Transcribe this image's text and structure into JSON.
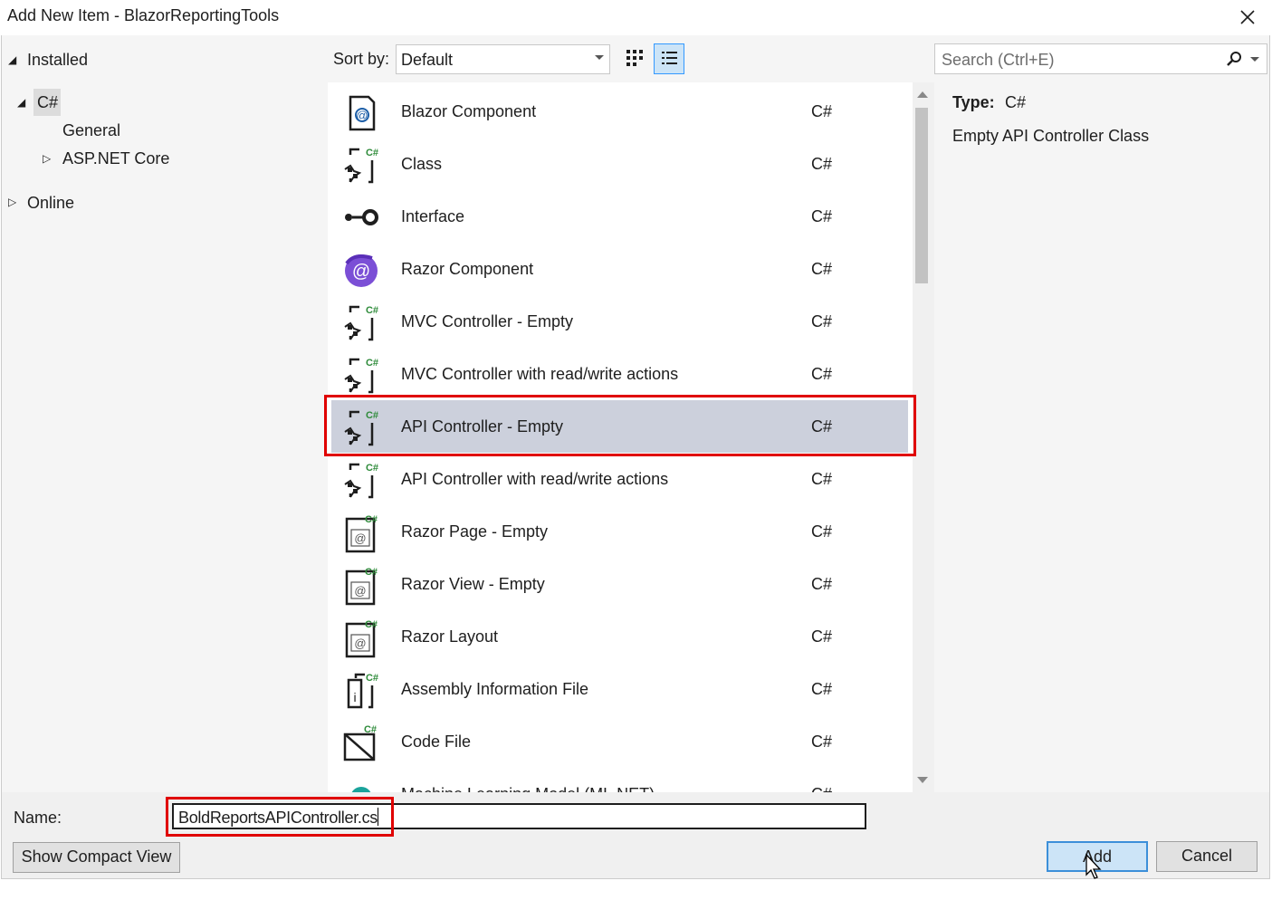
{
  "window": {
    "title": "Add New Item - BlazorReportingTools"
  },
  "tree": {
    "installed": "Installed",
    "csharp": "C#",
    "general": "General",
    "aspnet": "ASP.NET Core",
    "online": "Online"
  },
  "toolbar": {
    "sort_label": "Sort by:",
    "sort_value": "Default",
    "search_placeholder": "Search (Ctrl+E)"
  },
  "templates": [
    {
      "name": "Blazor Component",
      "lang": "C#",
      "icon": "blazor-component-icon"
    },
    {
      "name": "Class",
      "lang": "C#",
      "icon": "class-icon"
    },
    {
      "name": "Interface",
      "lang": "C#",
      "icon": "interface-icon"
    },
    {
      "name": "Razor Component",
      "lang": "C#",
      "icon": "razor-component-icon"
    },
    {
      "name": "MVC Controller - Empty",
      "lang": "C#",
      "icon": "controller-icon"
    },
    {
      "name": "MVC Controller with read/write actions",
      "lang": "C#",
      "icon": "controller-icon"
    },
    {
      "name": "API Controller - Empty",
      "lang": "C#",
      "icon": "controller-icon",
      "selected": true
    },
    {
      "name": "API Controller with read/write actions",
      "lang": "C#",
      "icon": "controller-icon"
    },
    {
      "name": "Razor Page - Empty",
      "lang": "C#",
      "icon": "razor-page-icon"
    },
    {
      "name": "Razor View - Empty",
      "lang": "C#",
      "icon": "razor-page-icon"
    },
    {
      "name": "Razor Layout",
      "lang": "C#",
      "icon": "razor-page-icon"
    },
    {
      "name": "Assembly Information File",
      "lang": "C#",
      "icon": "assembly-info-icon"
    },
    {
      "name": "Code File",
      "lang": "C#",
      "icon": "code-file-icon"
    },
    {
      "name": "Machine Learning Model (ML.NET)",
      "lang": "C#",
      "icon": "ml-model-icon"
    }
  ],
  "details": {
    "type_label": "Type:",
    "type_value": "C#",
    "description": "Empty API Controller Class"
  },
  "footer": {
    "name_label": "Name:",
    "name_value": "BoldReportsAPIController.cs",
    "compact_label": "Show Compact View",
    "add_label": "Add",
    "cancel_label": "Cancel"
  },
  "colors": {
    "highlight": "#e00000",
    "selection": "#ccd0dc",
    "accent": "#3c8fd9"
  }
}
